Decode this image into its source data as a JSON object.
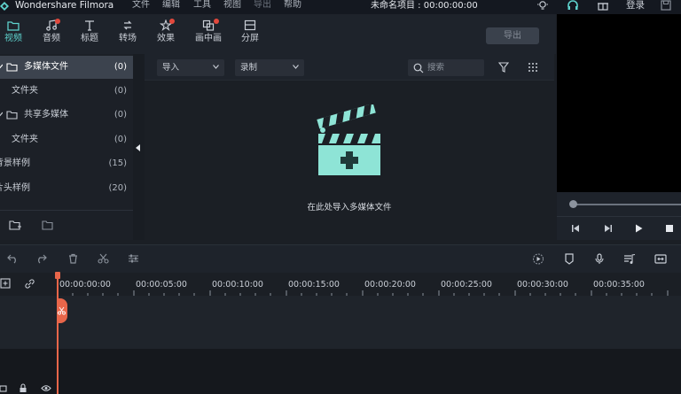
{
  "titlebar": {
    "app_title": "Wondershare Filmora",
    "menus": [
      "文件",
      "编辑",
      "工具",
      "视图",
      "导出",
      "帮助"
    ],
    "project": "未命名项目 : 00:00:00:00",
    "login": "登录"
  },
  "tabs": [
    {
      "label": "视频",
      "icon": "folder-icon",
      "active": true,
      "dot": false
    },
    {
      "label": "音频",
      "icon": "music-note-icon",
      "active": false,
      "dot": true
    },
    {
      "label": "标题",
      "icon": "text-icon",
      "active": false,
      "dot": false
    },
    {
      "label": "转场",
      "icon": "transition-icon",
      "active": false,
      "dot": false
    },
    {
      "label": "效果",
      "icon": "effects-icon",
      "active": false,
      "dot": true
    },
    {
      "label": "画中画",
      "icon": "pip-icon",
      "active": false,
      "dot": true
    },
    {
      "label": "分屏",
      "icon": "split-screen-icon",
      "active": false,
      "dot": false
    }
  ],
  "export_label": "导出",
  "library": [
    {
      "name": "多媒体文件",
      "count": "(0)",
      "selected": true,
      "folder": true
    },
    {
      "name": "文件夹",
      "count": "(0)",
      "selected": false,
      "folder": false
    },
    {
      "name": "共享多媒体",
      "count": "(0)",
      "selected": false,
      "folder": true
    },
    {
      "name": "文件夹",
      "count": "(0)",
      "selected": false,
      "folder": false
    },
    {
      "name": "背景样例",
      "count": "(15)",
      "selected": false,
      "folder": false
    },
    {
      "name": "片头样例",
      "count": "(20)",
      "selected": false,
      "folder": false
    }
  ],
  "media": {
    "import_label": "导入",
    "record_label": "录制",
    "search_placeholder": "搜索",
    "empty_text": "在此处导入多媒体文件"
  },
  "timeline": {
    "ticks": [
      "00:00:00:00",
      "00:00:05:00",
      "00:00:10:00",
      "00:00:15:00",
      "00:00:20:00",
      "00:00:25:00",
      "00:00:30:00",
      "00:00:35:00"
    ]
  },
  "colors": {
    "accent": "#5fd3ce",
    "playhead": "#e8664a",
    "badge": "#e2483c"
  }
}
